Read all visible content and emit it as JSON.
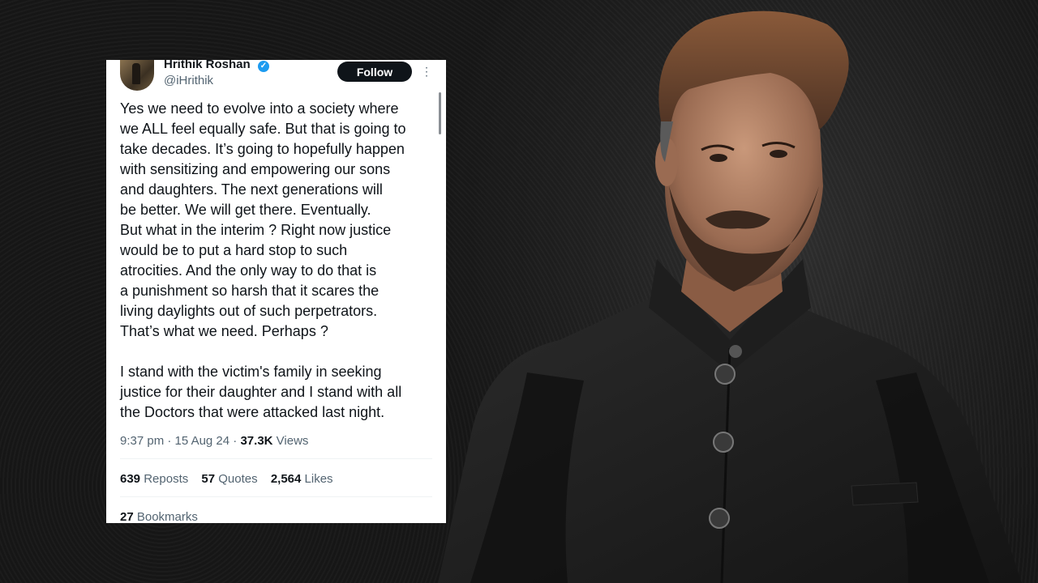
{
  "tweet": {
    "author_name": "Hrithik Roshan",
    "handle": "@iHrithik",
    "follow_label": "Follow",
    "more_icon": "more-vertical-icon",
    "body_lines": [
      "Yes we need to evolve into a society where",
      "we ALL feel equally safe. But that is going to",
      "take decades. It’s going to hopefully happen",
      "with sensitizing and empowering our sons",
      "and daughters. The next generations will",
      "be better. We will get there. Eventually.",
      "But what in the interim ? Right now justice",
      "would be to put a hard stop to such",
      "atrocities. And the only way to do that is",
      "a punishment so harsh that it scares the",
      "living daylights out of such perpetrators.",
      "That’s what we need. Perhaps ?"
    ],
    "body_lines_2": [
      "I stand with the victim's family in seeking",
      "justice for their daughter and I stand with all",
      "the Doctors that were attacked last night."
    ],
    "time": "9:37 pm",
    "date": "15 Aug 24",
    "views_count": "37.3K",
    "views_label": "Views",
    "reposts_count": "639",
    "reposts_label": "Reposts",
    "quotes_count": "57",
    "quotes_label": "Quotes",
    "likes_count": "2,564",
    "likes_label": "Likes",
    "bookmarks_count": "27",
    "bookmarks_label": "Bookmarks"
  },
  "colors": {
    "follow_bg": "#0f1419",
    "verified": "#1d9bf0",
    "secondary_text": "#536471"
  }
}
